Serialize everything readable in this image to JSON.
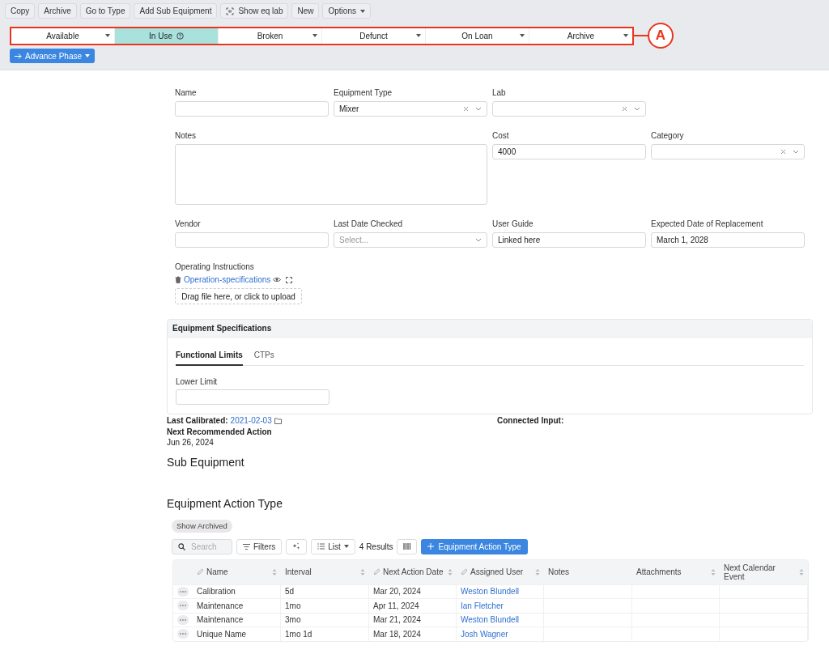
{
  "toolbar": {
    "buttons": [
      {
        "label": "Copy",
        "kind": "plain"
      },
      {
        "label": "Archive",
        "kind": "plain"
      },
      {
        "label": "Go to Type",
        "kind": "plain"
      },
      {
        "label": "Add Sub Equipment",
        "kind": "plain"
      },
      {
        "label": "Show eq lab",
        "kind": "icon"
      },
      {
        "label": "New",
        "kind": "plain"
      },
      {
        "label": "Options",
        "kind": "menu"
      }
    ]
  },
  "phases": [
    {
      "label": "Available",
      "selected": false
    },
    {
      "label": "In Use",
      "selected": true
    },
    {
      "label": "Broken",
      "selected": false
    },
    {
      "label": "Defunct",
      "selected": false
    },
    {
      "label": "On Loan",
      "selected": false
    },
    {
      "label": "Archive",
      "selected": false
    }
  ],
  "annotation": {
    "label": "A"
  },
  "advance_button": {
    "label": "Advance Phase"
  },
  "form": {
    "fields": [
      {
        "label": "Name",
        "kind": "text"
      },
      {
        "label": "Equipment Type",
        "kind": "select",
        "value": "Mixer",
        "clearable": true
      },
      {
        "label": "Lab",
        "kind": "select",
        "clearable": true
      },
      {
        "label": "Notes",
        "kind": "textarea"
      },
      {
        "label": "Cost",
        "kind": "text",
        "value": "4000"
      },
      {
        "label": "Category",
        "kind": "select",
        "clearable": true
      },
      {
        "label": "Vendor",
        "kind": "text"
      },
      {
        "label": "Last Date Checked",
        "kind": "select",
        "placeholder": "Select...",
        "clearable": false
      },
      {
        "label": "User Guide",
        "kind": "text",
        "value": "Linked here"
      },
      {
        "label": "Expected Date of Replacement",
        "kind": "text",
        "value": "March 1, 2028"
      }
    ]
  },
  "operating_instructions": {
    "label": "Operating Instructions",
    "file": "Operation-specifications",
    "upload": "Drag file here, or click to upload"
  },
  "specifications": {
    "title": "Equipment Specifications",
    "tabs": [
      {
        "label": "Functional Limits",
        "selected": true
      },
      {
        "label": "CTPs",
        "selected": false
      }
    ],
    "field": {
      "label": "Lower Limit"
    }
  },
  "info": {
    "last_calibrated": {
      "label": "Last Calibrated:",
      "value": "2021-02-03"
    },
    "connected_input": {
      "label": "Connected Input:"
    },
    "next_action": {
      "label": "Next Recommended Action",
      "value": "Jun 26, 2024"
    }
  },
  "sub_equipment": {
    "title": "Sub Equipment"
  },
  "action_types": {
    "title": "Equipment Action Type",
    "show_archived": "Show Archived",
    "search_placeholder": "Search",
    "filters": "Filters",
    "view": "List",
    "results": "4 Results",
    "add_button": "Equipment Action Type",
    "columns": [
      {
        "label": "Name",
        "editable": true,
        "sortable": true,
        "kind": "text"
      },
      {
        "label": "Interval",
        "editable": false,
        "sortable": true,
        "kind": "text"
      },
      {
        "label": "Next Action Date",
        "editable": true,
        "sortable": true,
        "kind": "text"
      },
      {
        "label": "Assigned User",
        "editable": true,
        "sortable": true,
        "kind": "link"
      },
      {
        "label": "Notes",
        "editable": false,
        "sortable": false
      },
      {
        "label": "Attachments",
        "editable": false,
        "sortable": true
      },
      {
        "label": "Next Calendar Event",
        "editable": false,
        "sortable": true
      }
    ],
    "rows": [
      {
        "cells": [
          "Calibration",
          "5d",
          "Mar 20, 2024",
          "Weston Blundell"
        ]
      },
      {
        "cells": [
          "Maintenance",
          "1mo",
          "Apr 11, 2024",
          "Ian Fletcher"
        ]
      },
      {
        "cells": [
          "Maintenance",
          "3mo",
          "Mar 21, 2024",
          "Weston Blundell"
        ]
      },
      {
        "cells": [
          "Unique Name",
          "1mo 1d",
          "Mar 18, 2024",
          "Josh Wagner"
        ]
      }
    ]
  }
}
